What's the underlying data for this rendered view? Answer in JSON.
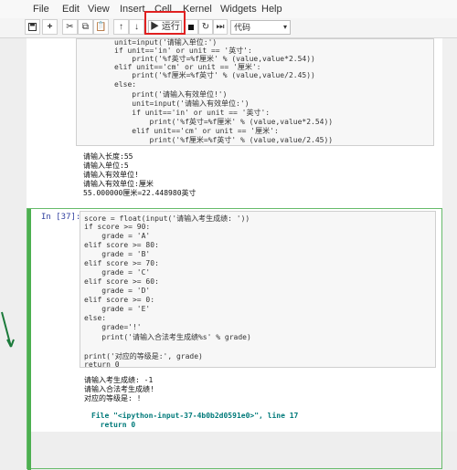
{
  "menubar": {
    "items": [
      "File",
      "Edit",
      "View",
      "Insert",
      "Cell",
      "Kernel",
      "Widgets",
      "Help"
    ]
  },
  "toolbar": {
    "run_label": "▶ 运行",
    "cell_type": "代码",
    "buttons": [
      "save-icon",
      "add-cell-icon",
      "cut-icon",
      "copy-icon",
      "paste-icon",
      "move-up-icon",
      "move-down-icon",
      "interrupt-icon",
      "restart-icon",
      "fast-forward-icon"
    ]
  },
  "cell1": {
    "code": [
      "unit=input('请输入单位:')",
      "if unit=='in' or unit == '英寸':",
      "    print('%f英寸=%f厘米' % (value,value*2.54))",
      "elif unit=='cm' or unit == '厘米':",
      "    print('%f厘米=%f英寸' % (value,value/2.45))",
      "else:",
      "    print('请输入有效单位!')",
      "    unit=input('请输入有效单位:')",
      "    if unit=='in' or unit == '英寸':",
      "        print('%f英寸=%f厘米' % (value,value*2.54))",
      "    elif unit=='cm' or unit == '厘米':",
      "        print('%f厘米=%f英寸' % (value,value/2.45))"
    ],
    "output": [
      "请输入长度:55",
      "请输入单位:5",
      "请输入有效单位!",
      "请输入有效单位:厘米",
      "55.000000厘米=22.448980英寸"
    ]
  },
  "cell2": {
    "prompt": "In  [37]:",
    "code": [
      "score = float(input('请输入考生成绩: '))",
      "if score >= 90:",
      "    grade = 'A'",
      "elif score >= 80:",
      "    grade = 'B'",
      "elif score >= 70:",
      "    grade = 'C'",
      "elif score >= 60:",
      "    grade = 'D'",
      "elif score >= 0:",
      "    grade = 'E'",
      "else:",
      "    grade='!'",
      "    print('请输入合法考生成绩%s' % grade)",
      "",
      "print('对应的等级是:', grade)",
      "return 0"
    ],
    "output": [
      "请输入考生成绩: -1",
      "请输入合法考生成绩!",
      "对应的等级是: !"
    ],
    "error": [
      "File \"<ipython-input-37-4b0b2d0591e0>\", line 17",
      "  return 0"
    ]
  }
}
